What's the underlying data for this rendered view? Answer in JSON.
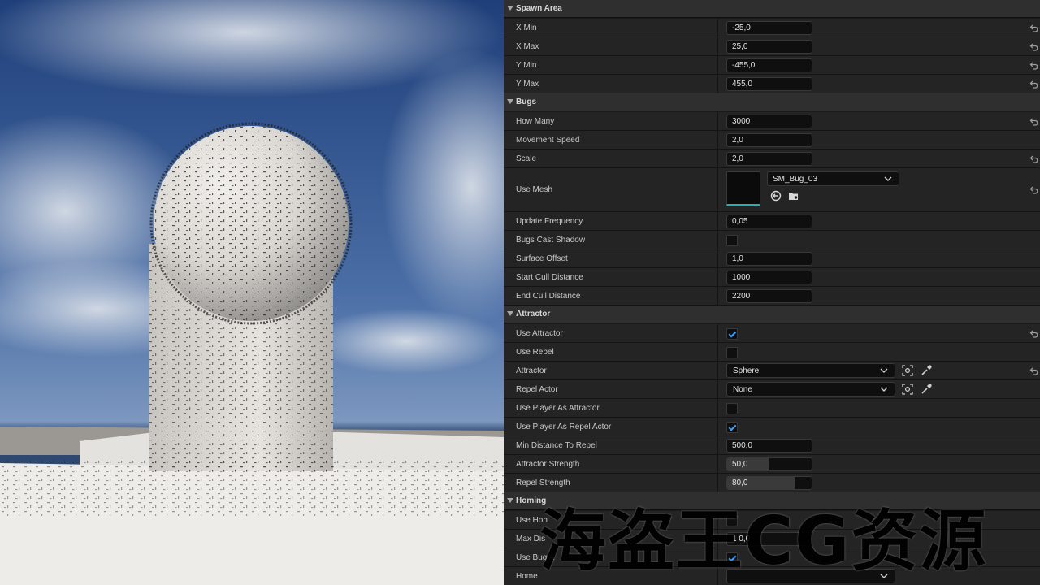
{
  "categories": [
    {
      "label": "Spawn Area",
      "rows": [
        {
          "name": "X Min",
          "value": "-25,0"
        },
        {
          "name": "X Max",
          "value": "25,0"
        },
        {
          "name": "Y Min",
          "value": "-455,0"
        },
        {
          "name": "Y Max",
          "value": "455,0"
        }
      ]
    },
    {
      "label": "Bugs",
      "rows": [
        {
          "name": "How Many",
          "value": "3000"
        },
        {
          "name": "Movement Speed",
          "value": "2,0"
        },
        {
          "name": "Scale",
          "value": "2,0"
        },
        {
          "name": "Use Mesh",
          "value": "SM_Bug_03"
        },
        {
          "name": "Update Frequency",
          "value": "0,05"
        },
        {
          "name": "Bugs Cast Shadow",
          "checked": false
        },
        {
          "name": "Surface Offset",
          "value": "1,0"
        },
        {
          "name": "Start Cull Distance",
          "value": "1000"
        },
        {
          "name": "End Cull Distance",
          "value": "2200"
        }
      ]
    },
    {
      "label": "Attractor",
      "rows": [
        {
          "name": "Use Attractor",
          "checked": true
        },
        {
          "name": "Use Repel",
          "checked": false
        },
        {
          "name": "Attractor",
          "value": "Sphere"
        },
        {
          "name": "Repel Actor",
          "value": "None"
        },
        {
          "name": "Use Player As Attractor",
          "checked": false
        },
        {
          "name": "Use Player As Repel Actor",
          "checked": true
        },
        {
          "name": "Min Distance To Repel",
          "value": "500,0"
        },
        {
          "name": "Attractor Strength",
          "value": "50,0",
          "slider_fraction": 0.5
        },
        {
          "name": "Repel Strength",
          "value": "80,0",
          "slider_fraction": 0.8
        }
      ]
    },
    {
      "label": "Homing",
      "rows": [
        {
          "name": "Use Hon",
          "checked": false
        },
        {
          "name": "Max Dis",
          "name_tail": "e Fr",
          "value": "1 0,0"
        },
        {
          "name": "Use Bug A",
          "checked": true
        },
        {
          "name": "Home",
          "value": ""
        }
      ]
    }
  ],
  "watermark": "海盗王CG资源",
  "colors": {
    "sky": "#3e5f93",
    "panel_bg": "#1a1a1a",
    "row_bg": "#242424",
    "category_bg": "#2f2f2f",
    "check_accent": "#3aa0ff",
    "thumbnail_accent": "#22b0b0"
  },
  "icons": {
    "reset": "reset-arrow-icon",
    "picker": "actor-picker-icon",
    "eyedropper": "eyedropper-icon",
    "browse": "browse-asset-icon",
    "use_selected": "use-selected-icon",
    "dropdown": "chevron-down-icon"
  }
}
